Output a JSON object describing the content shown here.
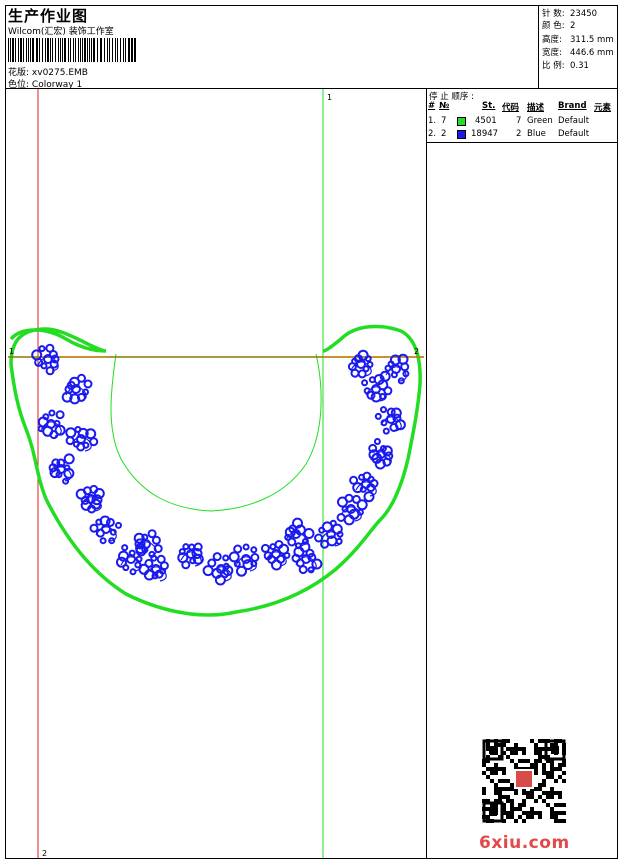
{
  "header": {
    "title": "生产作业图",
    "company": "Wilcom(汇宏) 装饰工作室",
    "design_label": "花版:",
    "design_value": "xv0275.EMB",
    "colorway_label": "色位:",
    "colorway_value": "Colorway 1"
  },
  "stats": [
    {
      "label": "针 数:",
      "value": "23450"
    },
    {
      "label": "颜 色:",
      "value": "2"
    },
    {
      "label": "高度:",
      "value": "311.5 mm"
    },
    {
      "label": "宽度:",
      "value": "446.6 mm"
    },
    {
      "label": "比 例:",
      "value": "0.31"
    }
  ],
  "sequence": {
    "title": "停 止 顺序 :",
    "columns": [
      "#",
      "№",
      "St.",
      "代码",
      "描述",
      "Brand",
      "元素"
    ],
    "rows": [
      {
        "index": "1.",
        "no": "7",
        "color": "#22dd22",
        "stitches": "4501",
        "code": "7",
        "desc": "Green",
        "brand": "Default"
      },
      {
        "index": "2.",
        "no": "2",
        "color": "#1a1aee",
        "stitches": "18947",
        "code": "2",
        "desc": "Blue",
        "brand": "Default"
      }
    ]
  },
  "markers": {
    "top_green": "1",
    "left_orange": "1",
    "right_orange": "2",
    "bottom_red": "2"
  },
  "watermark": "6xiu.com",
  "colors": {
    "green": "#22dd22",
    "blue": "#1a1aee",
    "red": "#e02020",
    "orange": "#cc7a00"
  }
}
